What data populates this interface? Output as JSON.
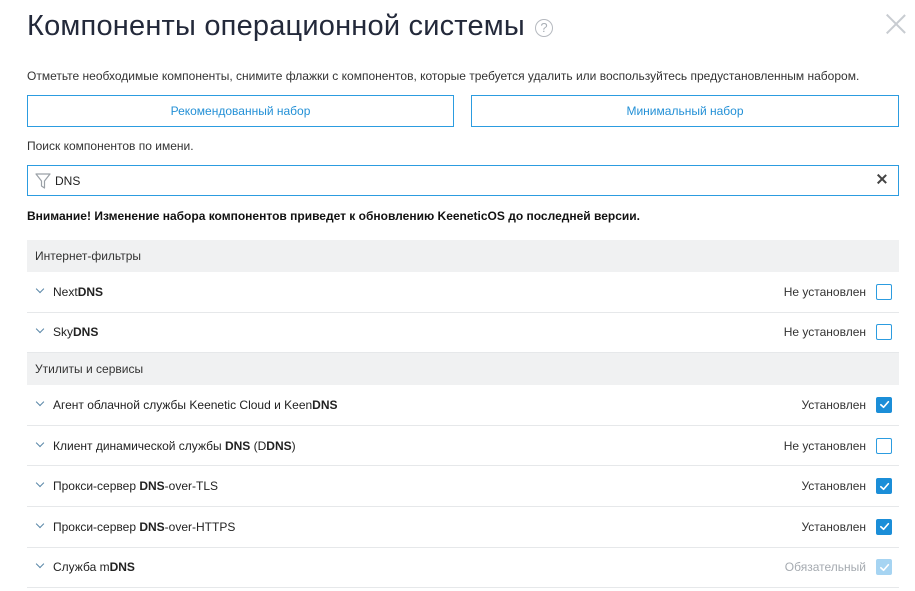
{
  "dialog": {
    "title": "Компоненты операционной системы",
    "help_glyph": "?",
    "hint": "Отметьте необходимые компоненты, снимите флажки с компонентов, которые требуется удалить или воспользуйтесь предустановленным набором."
  },
  "presets": {
    "recommended_label": "Рекомендованный набор",
    "minimal_label": "Минимальный набор"
  },
  "search": {
    "label": "Поиск компонентов по имени.",
    "value": "DNS"
  },
  "warning": "Внимание! Изменение набора компонентов приведет к обновлению KeeneticOS до последней версии.",
  "groups": [
    {
      "name": "Интернет-фильтры",
      "items": [
        {
          "name_parts": [
            [
              "Next",
              false
            ],
            [
              "DNS",
              true
            ]
          ],
          "status": "Не установлен",
          "checked": false,
          "disabled": false
        },
        {
          "name_parts": [
            [
              "Sky",
              false
            ],
            [
              "DNS",
              true
            ]
          ],
          "status": "Не установлен",
          "checked": false,
          "disabled": false
        }
      ]
    },
    {
      "name": "Утилиты и сервисы",
      "items": [
        {
          "name_parts": [
            [
              "Агент облачной службы Keenetic Cloud и Keen",
              false
            ],
            [
              "DNS",
              true
            ]
          ],
          "status": "Установлен",
          "checked": true,
          "disabled": false
        },
        {
          "name_parts": [
            [
              "Клиент динамической службы ",
              false
            ],
            [
              "DNS",
              true
            ],
            [
              " (D",
              false
            ],
            [
              "DNS",
              true
            ],
            [
              ")",
              false
            ]
          ],
          "status": "Не установлен",
          "checked": false,
          "disabled": false
        },
        {
          "name_parts": [
            [
              "Прокси-сервер ",
              false
            ],
            [
              "DNS",
              true
            ],
            [
              "-over-TLS",
              false
            ]
          ],
          "status": "Установлен",
          "checked": true,
          "disabled": false
        },
        {
          "name_parts": [
            [
              "Прокси-сервер ",
              false
            ],
            [
              "DNS",
              true
            ],
            [
              "-over-HTTPS",
              false
            ]
          ],
          "status": "Установлен",
          "checked": true,
          "disabled": false
        },
        {
          "name_parts": [
            [
              "Служба m",
              false
            ],
            [
              "DNS",
              true
            ]
          ],
          "status": "Обязательный",
          "checked": true,
          "disabled": true
        }
      ]
    }
  ],
  "icons": {
    "help": "help-icon",
    "close": "close-icon",
    "filter": "funnel-icon",
    "clear": "clear-icon",
    "expand": "chevron-down-icon",
    "check": "checkmark-icon"
  },
  "colors": {
    "accent": "#2c9ce0",
    "checked": "#1b8ed8",
    "disabled_checked": "#a6d4f2",
    "group_bg": "#f0f1f2"
  }
}
